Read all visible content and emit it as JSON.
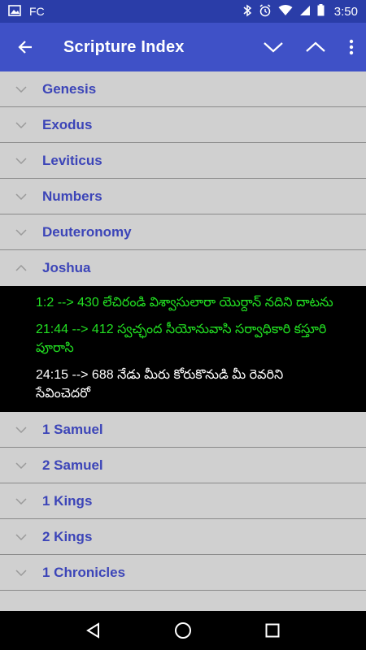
{
  "status": {
    "app_label": "FC",
    "time": "3:50"
  },
  "appbar": {
    "title": "Scripture Index"
  },
  "books_before": [
    {
      "name": "Genesis"
    },
    {
      "name": "Exodus"
    },
    {
      "name": "Leviticus"
    },
    {
      "name": "Numbers"
    },
    {
      "name": "Deuteronomy"
    }
  ],
  "expanded_book": {
    "name": "Joshua",
    "verses": [
      {
        "text": "1:2 --> 430 లేచిరండి విశ్వాసులారా యొర్దాన్ నదిని దాటను",
        "color": "#22e022"
      },
      {
        "text": "21:44 --> 412 స్వచ్ఛంద సీయోనువాసి సర్వాధికారి కస్తూరి పూరాసి",
        "color": "#22e022"
      },
      {
        "text": "24:15 --> 688 నేడు మీరు కోరుకొనుడి మీ రెవరిని సేవించెదరో",
        "color": "#ffffff"
      }
    ]
  },
  "books_after": [
    {
      "name": "1 Samuel"
    },
    {
      "name": "2 Samuel"
    },
    {
      "name": "1 Kings"
    },
    {
      "name": "2 Kings"
    },
    {
      "name": "1 Chronicles"
    }
  ],
  "colors": {
    "statusbar": "#2a3da8",
    "appbar": "#3f51c7",
    "book_label": "#3c45b8",
    "list_bg": "#d0d0d0",
    "verse_bg": "#000000"
  }
}
